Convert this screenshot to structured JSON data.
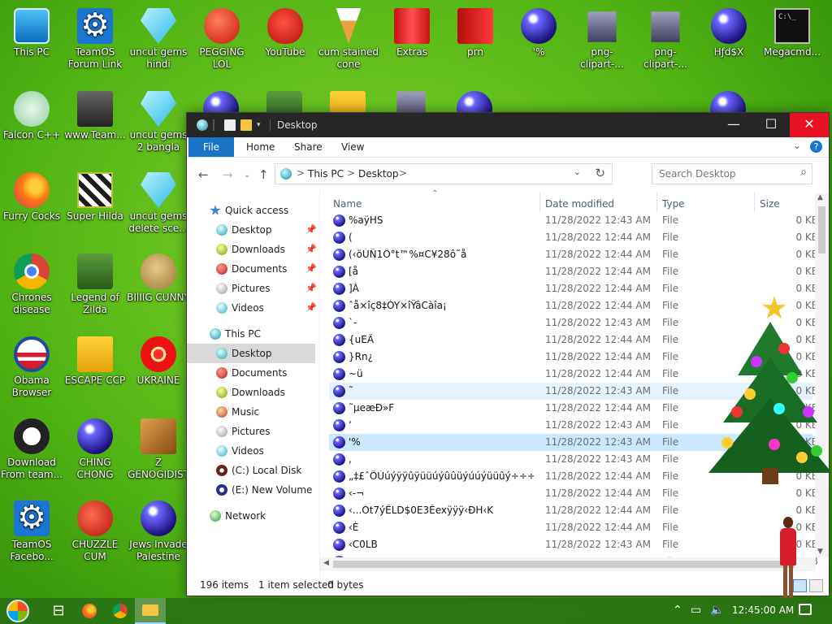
{
  "desktop": {
    "icons": [
      {
        "label": "This PC"
      },
      {
        "label": "TeamOS Forum Link"
      },
      {
        "label": "uncut gems hindi"
      },
      {
        "label": "PEGGING LOL"
      },
      {
        "label": "YouTube"
      },
      {
        "label": "cum stained cone"
      },
      {
        "label": "Extras"
      },
      {
        "label": "prn"
      },
      {
        "label": "'%"
      },
      {
        "label": "png-clipart-..."
      },
      {
        "label": "png-clipart-..."
      },
      {
        "label": "Hƒd$X"
      },
      {
        "label": "Megacmd..."
      },
      {
        "label": "Falcon C++"
      },
      {
        "label": "www.Team..."
      },
      {
        "label": "uncut gems 2 bangla"
      },
      {
        "label": "Furry Cocks"
      },
      {
        "label": "Super Hilda"
      },
      {
        "label": "uncut gems delete sce..."
      },
      {
        "label": "Chrones disease"
      },
      {
        "label": "Legend of Zilda"
      },
      {
        "label": "BIlIIG CUNNY"
      },
      {
        "label": "Obama Browser"
      },
      {
        "label": "ESCAPE CCP"
      },
      {
        "label": "UKRAINE"
      },
      {
        "label": "Download From team..."
      },
      {
        "label": "CHING CHONG"
      },
      {
        "label": "Z GENOGIDIST"
      },
      {
        "label": "TeamOS Facebo..."
      },
      {
        "label": "CHUZZLE CUM"
      },
      {
        "label": "Jews Invade Palestine"
      }
    ]
  },
  "window": {
    "title": "Desktop",
    "ribbon": {
      "file": "File",
      "home": "Home",
      "share": "Share",
      "view": "View",
      "help": "?"
    },
    "address": {
      "this_pc": "This PC",
      "desktop": "Desktop",
      "sep": ">"
    },
    "search_placeholder": "Search Desktop",
    "nav": {
      "quick_access": "Quick access",
      "qa_items": [
        "Desktop",
        "Downloads",
        "Documents",
        "Pictures",
        "Videos"
      ],
      "this_pc": "This PC",
      "pc_items": [
        "Desktop",
        "Documents",
        "Downloads",
        "Music",
        "Pictures",
        "Videos",
        "(C:) Local Disk",
        "(E:) New Volume"
      ],
      "network": "Network"
    },
    "columns": {
      "name": "Name",
      "date": "Date modified",
      "type": "Type",
      "size": "Size"
    },
    "files": [
      {
        "name": "%aÿHS",
        "date": "11/28/2022 12:43 AM",
        "type": "File",
        "size": "0 KB"
      },
      {
        "name": "(",
        "date": "11/28/2022 12:44 AM",
        "type": "File",
        "size": "0 KB"
      },
      {
        "name": "(‹öÙÑ1Ô°t™%¤C¥28ô˜å",
        "date": "11/28/2022 12:44 AM",
        "type": "File",
        "size": "0 KB"
      },
      {
        "name": "[å",
        "date": "11/28/2022 12:44 AM",
        "type": "File",
        "size": "0 KB"
      },
      {
        "name": "]À",
        "date": "11/28/2022 12:44 AM",
        "type": "File",
        "size": "0 KB"
      },
      {
        "name": "ˆå×îç8‡ÓY×îŸâCàîa¡",
        "date": "11/28/2022 12:44 AM",
        "type": "File",
        "size": "0 KB"
      },
      {
        "name": "`-",
        "date": "11/28/2022 12:43 AM",
        "type": "File",
        "size": "0 KB"
      },
      {
        "name": "{uEÃ",
        "date": "11/28/2022 12:44 AM",
        "type": "File",
        "size": "0 KB"
      },
      {
        "name": "}Rn¿",
        "date": "11/28/2022 12:44 AM",
        "type": "File",
        "size": "0 KB"
      },
      {
        "name": "~ü",
        "date": "11/28/2022 12:44 AM",
        "type": "File",
        "size": "0 KB"
      },
      {
        "name": "˜",
        "date": "11/28/2022 12:43 AM",
        "type": "File",
        "size": "0 KB"
      },
      {
        "name": "˜µeæÐ»F",
        "date": "11/28/2022 12:44 AM",
        "type": "File",
        "size": "0 KB"
      },
      {
        "name": "‘",
        "date": "11/28/2022 12:43 AM",
        "type": "File",
        "size": "0 KB"
      },
      {
        "name": "'%",
        "date": "11/28/2022 12:43 AM",
        "type": "File",
        "size": "0 KB"
      },
      {
        "name": ",",
        "date": "11/28/2022 12:43 AM",
        "type": "File",
        "size": "0 KB"
      },
      {
        "name": "„‡£ˆÕÙúýÿÿûÿüüúýûûüýúúýüüûý÷÷÷ÿ...",
        "date": "11/28/2022 12:44 AM",
        "type": "File",
        "size": "0 KB"
      },
      {
        "name": "‹-¬",
        "date": "11/28/2022 12:44 AM",
        "type": "File",
        "size": "0 KB"
      },
      {
        "name": "‹...Òt7ýÊLD$0E3Êexÿÿÿ‹ÐH‹K",
        "date": "11/28/2022 12:44 AM",
        "type": "File",
        "size": "0 KB"
      },
      {
        "name": "‹È",
        "date": "11/28/2022 12:44 AM",
        "type": "File",
        "size": "0 KB"
      },
      {
        "name": "‹C0LB",
        "date": "11/28/2022 12:43 AM",
        "type": "File",
        "size": "0 KB"
      },
      {
        "name": "‹N",
        "date": "11/28/2022 12:43 AM",
        "type": "File",
        "size": "0 KB"
      }
    ],
    "status": {
      "count": "196 items",
      "selected": "1 item selected",
      "bytes": "0 bytes"
    }
  },
  "taskbar": {
    "clock": "12:45:00 AM"
  }
}
